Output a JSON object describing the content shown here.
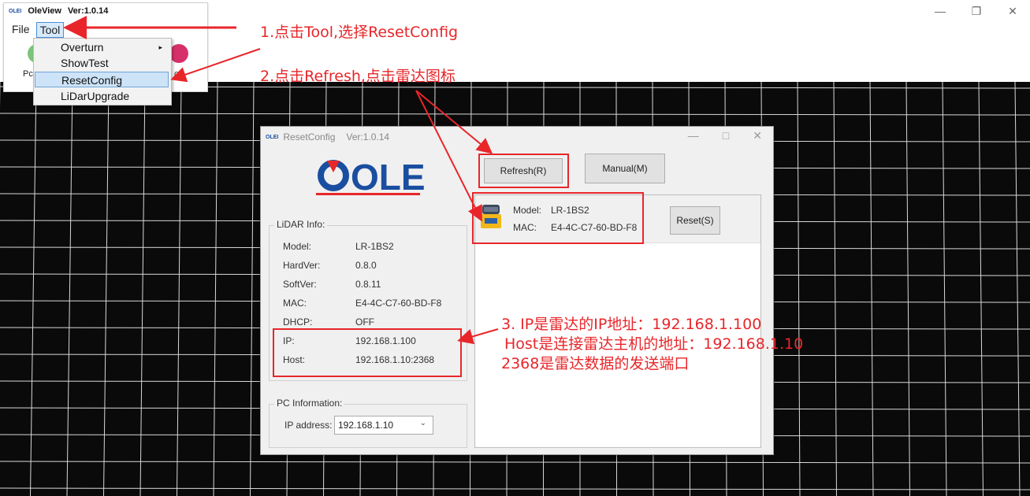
{
  "oleview": {
    "logo": "OLEI",
    "title": "OleView",
    "version": "Ver:1.0.14",
    "menu": [
      "File",
      "Tool"
    ],
    "toolbar_labels": [
      "Pca",
      "co"
    ],
    "dropdown_items": [
      "Overturn",
      "ShowTest",
      "ResetConfig",
      "LiDarUpgrade"
    ],
    "dropdown_arrow": "▸"
  },
  "window_controls": [
    "—",
    "❐",
    "✕"
  ],
  "annotations": {
    "step1": "1.点击Tool,选择ResetConfig",
    "step2": "2.点击Refresh,点击雷达图标",
    "step3_line1": "3. IP是雷达的IP地址：192.168.1.100",
    "step3_line2": "Host是连接雷达主机的地址：192.168.1.10",
    "step3_line3": "2368是雷达数据的发送端口"
  },
  "dialog": {
    "logo_small": "OLEI",
    "title": "ResetConfig",
    "version": "Ver:1.0.14",
    "controls": [
      "—",
      "□",
      "✕"
    ],
    "brand": "OLEI",
    "refresh_label": "Refresh(R)",
    "manual_label": "Manual(M)",
    "reset_label": "Reset(S)",
    "device": {
      "model_label": "Model:",
      "model_value": "LR-1BS2",
      "mac_label": "MAC:",
      "mac_value": "E4-4C-C7-60-BD-F8"
    },
    "lidar_info": {
      "title": "LiDAR Info:",
      "rows": [
        {
          "label": "Model:",
          "value": "LR-1BS2"
        },
        {
          "label": "HardVer:",
          "value": "0.8.0"
        },
        {
          "label": "SoftVer:",
          "value": "0.8.11"
        },
        {
          "label": "MAC:",
          "value": "E4-4C-C7-60-BD-F8"
        },
        {
          "label": "DHCP:",
          "value": "OFF"
        },
        {
          "label": "IP:",
          "value": "192.168.1.100"
        },
        {
          "label": "Host:",
          "value": "192.168.1.10:2368"
        }
      ]
    },
    "pc_info": {
      "title": "PC Information:",
      "ip_label": "IP address:",
      "ip_value": "192.168.1.10"
    }
  },
  "colors": {
    "accent_red": "#e8262a",
    "brand_blue": "#1a4ea0",
    "selection": "#cde3f7"
  }
}
